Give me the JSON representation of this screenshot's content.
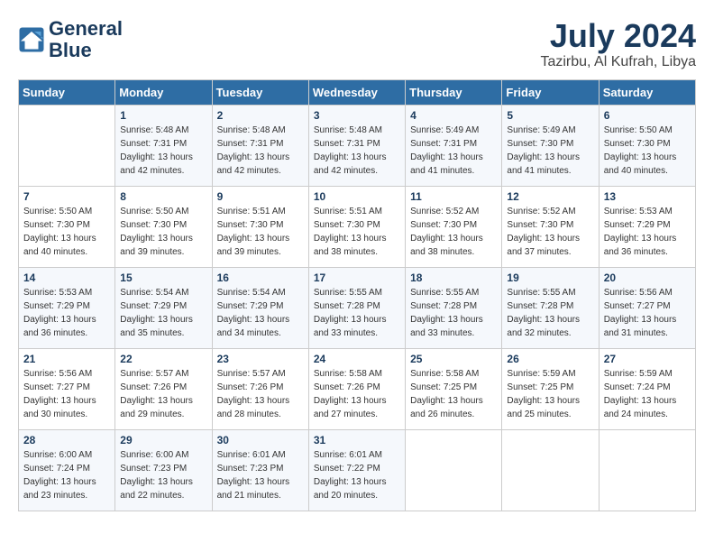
{
  "header": {
    "logo_line1": "General",
    "logo_line2": "Blue",
    "month_year": "July 2024",
    "location": "Tazirbu, Al Kufrah, Libya"
  },
  "days_of_week": [
    "Sunday",
    "Monday",
    "Tuesday",
    "Wednesday",
    "Thursday",
    "Friday",
    "Saturday"
  ],
  "weeks": [
    [
      {
        "day": "",
        "info": ""
      },
      {
        "day": "1",
        "info": "Sunrise: 5:48 AM\nSunset: 7:31 PM\nDaylight: 13 hours\nand 42 minutes."
      },
      {
        "day": "2",
        "info": "Sunrise: 5:48 AM\nSunset: 7:31 PM\nDaylight: 13 hours\nand 42 minutes."
      },
      {
        "day": "3",
        "info": "Sunrise: 5:48 AM\nSunset: 7:31 PM\nDaylight: 13 hours\nand 42 minutes."
      },
      {
        "day": "4",
        "info": "Sunrise: 5:49 AM\nSunset: 7:31 PM\nDaylight: 13 hours\nand 41 minutes."
      },
      {
        "day": "5",
        "info": "Sunrise: 5:49 AM\nSunset: 7:30 PM\nDaylight: 13 hours\nand 41 minutes."
      },
      {
        "day": "6",
        "info": "Sunrise: 5:50 AM\nSunset: 7:30 PM\nDaylight: 13 hours\nand 40 minutes."
      }
    ],
    [
      {
        "day": "7",
        "info": "Sunrise: 5:50 AM\nSunset: 7:30 PM\nDaylight: 13 hours\nand 40 minutes."
      },
      {
        "day": "8",
        "info": "Sunrise: 5:50 AM\nSunset: 7:30 PM\nDaylight: 13 hours\nand 39 minutes."
      },
      {
        "day": "9",
        "info": "Sunrise: 5:51 AM\nSunset: 7:30 PM\nDaylight: 13 hours\nand 39 minutes."
      },
      {
        "day": "10",
        "info": "Sunrise: 5:51 AM\nSunset: 7:30 PM\nDaylight: 13 hours\nand 38 minutes."
      },
      {
        "day": "11",
        "info": "Sunrise: 5:52 AM\nSunset: 7:30 PM\nDaylight: 13 hours\nand 38 minutes."
      },
      {
        "day": "12",
        "info": "Sunrise: 5:52 AM\nSunset: 7:30 PM\nDaylight: 13 hours\nand 37 minutes."
      },
      {
        "day": "13",
        "info": "Sunrise: 5:53 AM\nSunset: 7:29 PM\nDaylight: 13 hours\nand 36 minutes."
      }
    ],
    [
      {
        "day": "14",
        "info": "Sunrise: 5:53 AM\nSunset: 7:29 PM\nDaylight: 13 hours\nand 36 minutes."
      },
      {
        "day": "15",
        "info": "Sunrise: 5:54 AM\nSunset: 7:29 PM\nDaylight: 13 hours\nand 35 minutes."
      },
      {
        "day": "16",
        "info": "Sunrise: 5:54 AM\nSunset: 7:29 PM\nDaylight: 13 hours\nand 34 minutes."
      },
      {
        "day": "17",
        "info": "Sunrise: 5:55 AM\nSunset: 7:28 PM\nDaylight: 13 hours\nand 33 minutes."
      },
      {
        "day": "18",
        "info": "Sunrise: 5:55 AM\nSunset: 7:28 PM\nDaylight: 13 hours\nand 33 minutes."
      },
      {
        "day": "19",
        "info": "Sunrise: 5:55 AM\nSunset: 7:28 PM\nDaylight: 13 hours\nand 32 minutes."
      },
      {
        "day": "20",
        "info": "Sunrise: 5:56 AM\nSunset: 7:27 PM\nDaylight: 13 hours\nand 31 minutes."
      }
    ],
    [
      {
        "day": "21",
        "info": "Sunrise: 5:56 AM\nSunset: 7:27 PM\nDaylight: 13 hours\nand 30 minutes."
      },
      {
        "day": "22",
        "info": "Sunrise: 5:57 AM\nSunset: 7:26 PM\nDaylight: 13 hours\nand 29 minutes."
      },
      {
        "day": "23",
        "info": "Sunrise: 5:57 AM\nSunset: 7:26 PM\nDaylight: 13 hours\nand 28 minutes."
      },
      {
        "day": "24",
        "info": "Sunrise: 5:58 AM\nSunset: 7:26 PM\nDaylight: 13 hours\nand 27 minutes."
      },
      {
        "day": "25",
        "info": "Sunrise: 5:58 AM\nSunset: 7:25 PM\nDaylight: 13 hours\nand 26 minutes."
      },
      {
        "day": "26",
        "info": "Sunrise: 5:59 AM\nSunset: 7:25 PM\nDaylight: 13 hours\nand 25 minutes."
      },
      {
        "day": "27",
        "info": "Sunrise: 5:59 AM\nSunset: 7:24 PM\nDaylight: 13 hours\nand 24 minutes."
      }
    ],
    [
      {
        "day": "28",
        "info": "Sunrise: 6:00 AM\nSunset: 7:24 PM\nDaylight: 13 hours\nand 23 minutes."
      },
      {
        "day": "29",
        "info": "Sunrise: 6:00 AM\nSunset: 7:23 PM\nDaylight: 13 hours\nand 22 minutes."
      },
      {
        "day": "30",
        "info": "Sunrise: 6:01 AM\nSunset: 7:23 PM\nDaylight: 13 hours\nand 21 minutes."
      },
      {
        "day": "31",
        "info": "Sunrise: 6:01 AM\nSunset: 7:22 PM\nDaylight: 13 hours\nand 20 minutes."
      },
      {
        "day": "",
        "info": ""
      },
      {
        "day": "",
        "info": ""
      },
      {
        "day": "",
        "info": ""
      }
    ]
  ]
}
